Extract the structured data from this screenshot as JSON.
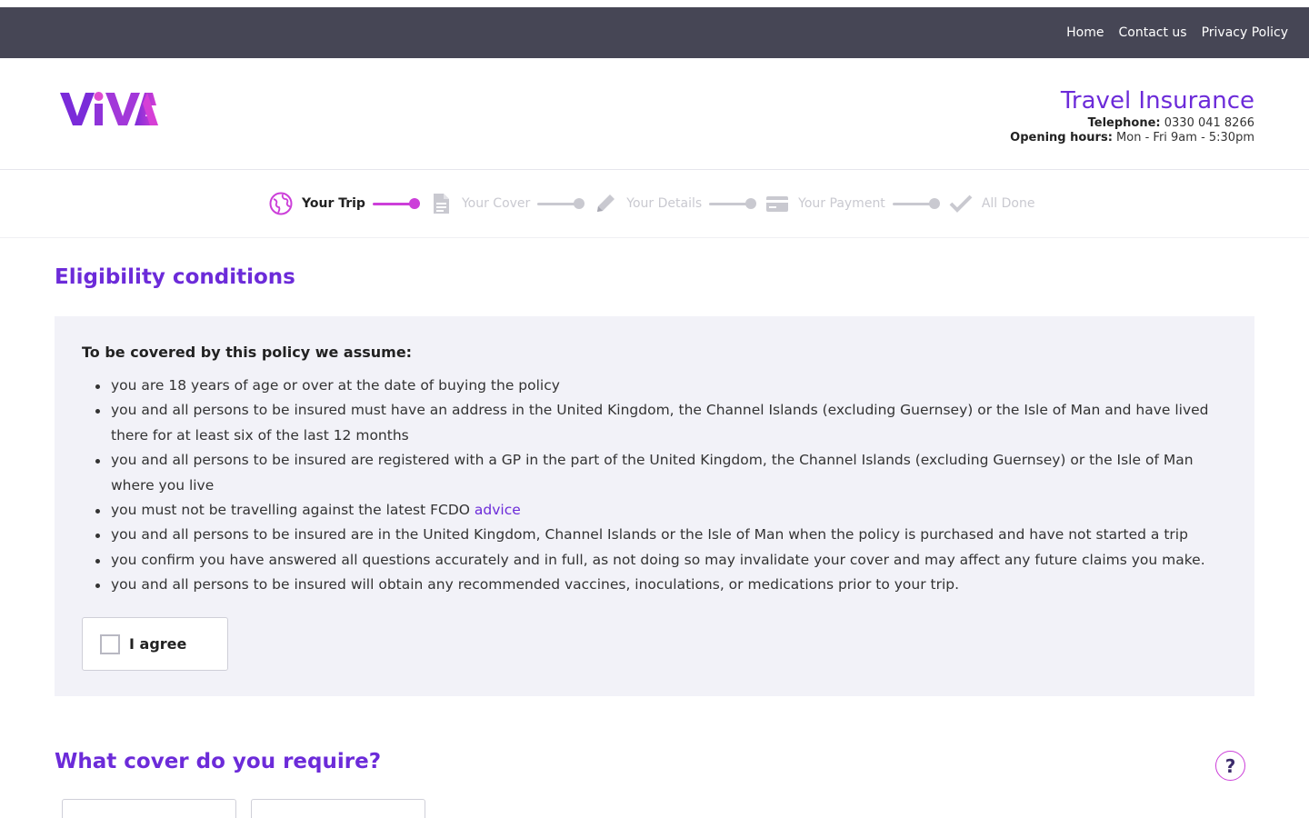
{
  "topnav": {
    "items": [
      {
        "label": "Home"
      },
      {
        "label": "Contact us"
      },
      {
        "label": "Privacy Policy"
      }
    ]
  },
  "header": {
    "logo_text": "ViVA",
    "title": "Travel Insurance",
    "telephone_label": "Telephone:",
    "telephone_value": "0330 041 8266",
    "hours_label": "Opening hours:",
    "hours_value": "Mon - Fri 9am - 5:30pm"
  },
  "stepper": {
    "steps": [
      {
        "label": "Your Trip",
        "icon": "globe-icon",
        "state": "active"
      },
      {
        "label": "Your Cover",
        "icon": "document-icon",
        "state": "inactive"
      },
      {
        "label": "Your Details",
        "icon": "pencil-icon",
        "state": "inactive"
      },
      {
        "label": "Your Payment",
        "icon": "credit-card-icon",
        "state": "inactive"
      },
      {
        "label": "All Done",
        "icon": "checkmark-icon",
        "state": "inactive"
      }
    ]
  },
  "eligibility": {
    "title": "Eligibility conditions",
    "intro": "To be covered by this policy we assume:",
    "conditions": [
      "you are 18 years of age or over at the date of buying the policy",
      "you and all persons to be insured must have an address in the United Kingdom, the Channel Islands (excluding Guernsey) or the Isle of Man and have lived there for at least six of the last 12 months",
      "you and all persons to be insured are registered with a GP in the part of the United Kingdom, the Channel Islands (excluding Guernsey) or the Isle of Man where you live",
      "you must not be travelling against the latest FCDO",
      "you and all persons to be insured are in the United Kingdom, Channel Islands or the Isle of Man when the policy is purchased and have not started a trip",
      "you confirm you have answered all questions accurately and in full, as not doing so may invalidate your cover and may affect any future claims you make.",
      "you and all persons to be insured will obtain any recommended vaccines, inoculations, or medications prior to your trip."
    ],
    "advice_link": "advice",
    "agree_label": "I agree",
    "agree_checked": false
  },
  "cover": {
    "title": "What cover do you require?",
    "help_label": "?"
  },
  "colors": {
    "topbar": "#464655",
    "brand_purple": "#6c2bd9",
    "accent_magenta": "#cc3fd9",
    "panel_bg": "#f2f2f8"
  }
}
